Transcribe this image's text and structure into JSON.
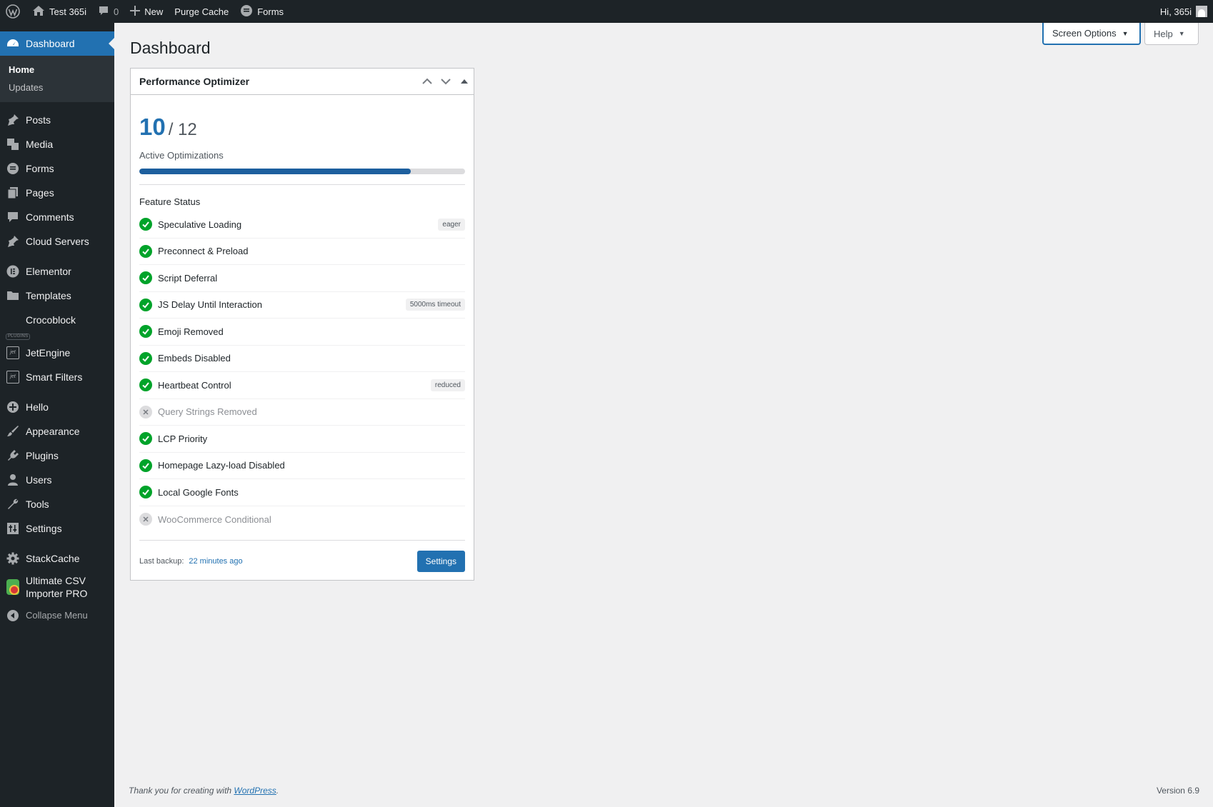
{
  "adminbar": {
    "site_name": "Test 365i",
    "comments_count": "0",
    "new_label": "New",
    "purge_label": "Purge Cache",
    "forms_label": "Forms",
    "greeting": "Hi, 365i"
  },
  "sidebar": {
    "dashboard": "Dashboard",
    "submenu": [
      "Home",
      "Updates"
    ],
    "items": {
      "posts": "Posts",
      "media": "Media",
      "forms": "Forms",
      "pages": "Pages",
      "comments": "Comments",
      "cloud_servers": "Cloud Servers",
      "elementor": "Elementor",
      "templates": "Templates",
      "crocoblock": "Crocoblock",
      "plugins_tag": "PLUGINS",
      "jetengine": "JetEngine",
      "smart_filters": "Smart Filters",
      "hello": "Hello",
      "appearance": "Appearance",
      "plugins": "Plugins",
      "users": "Users",
      "tools": "Tools",
      "settings": "Settings",
      "stackcache": "StackCache",
      "csv_line1": "Ultimate CSV",
      "csv_line2": "Importer PRO",
      "collapse": "Collapse Menu"
    }
  },
  "screen_meta": {
    "screen_options": "Screen Options",
    "help": "Help"
  },
  "page": {
    "title": "Dashboard"
  },
  "widget": {
    "title": "Performance Optimizer",
    "active_count": "10",
    "total": "/ 12",
    "active_label": "Active Optimizations",
    "progress": 0.833,
    "feature_title": "Feature Status",
    "features": [
      {
        "name": "Speculative Loading",
        "enabled": true,
        "badge": "eager"
      },
      {
        "name": "Preconnect & Preload",
        "enabled": true,
        "badge": ""
      },
      {
        "name": "Script Deferral",
        "enabled": true,
        "badge": ""
      },
      {
        "name": "JS Delay Until Interaction",
        "enabled": true,
        "badge": "5000ms timeout"
      },
      {
        "name": "Emoji Removed",
        "enabled": true,
        "badge": ""
      },
      {
        "name": "Embeds Disabled",
        "enabled": true,
        "badge": ""
      },
      {
        "name": "Heartbeat Control",
        "enabled": true,
        "badge": "reduced"
      },
      {
        "name": "Query Strings Removed",
        "enabled": false,
        "badge": ""
      },
      {
        "name": "LCP Priority",
        "enabled": true,
        "badge": ""
      },
      {
        "name": "Homepage Lazy-load Disabled",
        "enabled": true,
        "badge": ""
      },
      {
        "name": "Local Google Fonts",
        "enabled": true,
        "badge": ""
      },
      {
        "name": "WooCommerce Conditional",
        "enabled": false,
        "badge": ""
      }
    ],
    "backup_label": "Last backup:",
    "backup_time": "22 minutes ago",
    "settings_button": "Settings"
  },
  "footer": {
    "thanks_prefix": "Thank you for creating with ",
    "thanks_link": "WordPress",
    "thanks_suffix": ".",
    "version": "Version 6.9"
  },
  "colors": {
    "accent": "#2271b1",
    "sidebar_bg": "#1d2327",
    "enabled": "#00a32a",
    "disabled": "#dcdcde"
  }
}
